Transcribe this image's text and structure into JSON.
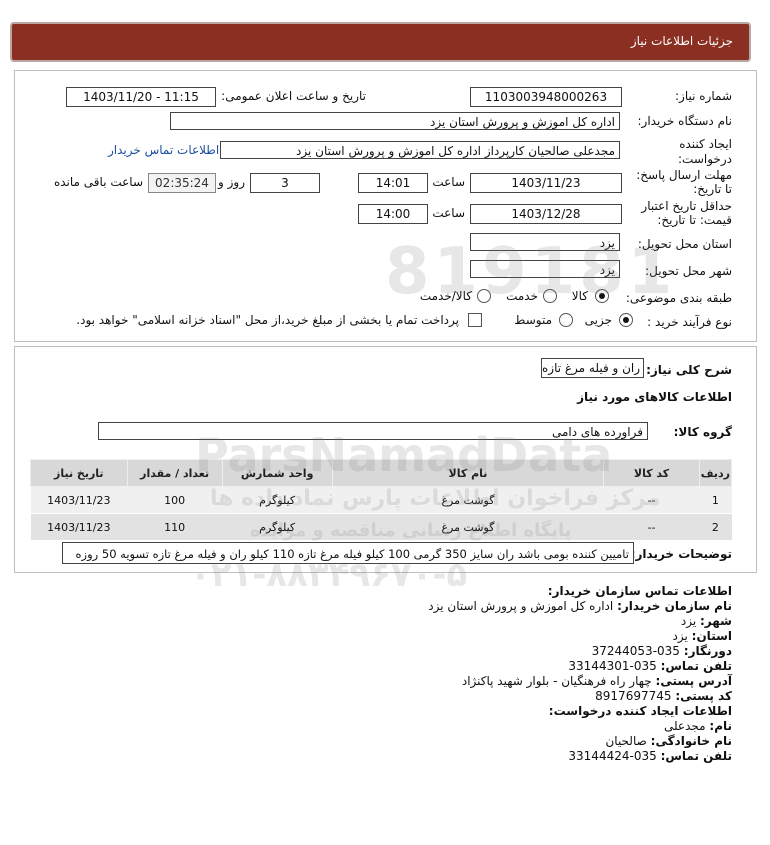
{
  "header": {
    "title": "جزئیات اطلاعات نیاز"
  },
  "form": {
    "need_number_label": "شماره نیاز:",
    "need_number": "1103003948000263",
    "announce_label": "تاریخ و ساعت اعلان عمومی:",
    "announce_value": "1403/11/20 - 11:15",
    "buyer_org_label": "نام دستگاه خریدار:",
    "buyer_org": "اداره کل اموزش و پرورش استان یزد",
    "creator_label_1": "ایجاد کننده",
    "creator_label_2": "درخواست:",
    "creator": "مجدعلی صالحیان کارپرداز اداره کل اموزش و پرورش استان یزد",
    "contact_link": "اطلاعات تماس خریدار",
    "deadline_label_1": "مهلت ارسال پاسخ:",
    "deadline_label_2": "تا تاریخ:",
    "deadline_date": "1403/11/23",
    "time_label": "ساعت",
    "deadline_time": "14:01",
    "days_value": "3",
    "days_label": "روز و",
    "countdown": "02:35:24",
    "remaining_label": "ساعت باقی مانده",
    "validity_label_1": "حداقل تاریخ اعتبار",
    "validity_label_2": "قیمت: تا تاریخ:",
    "validity_date": "1403/12/28",
    "validity_time": "14:00",
    "province_label": "استان محل تحویل:",
    "province": "یزد",
    "city_label": "شهر محل تحویل:",
    "city": "یزد",
    "category_label": "طبقه بندی موضوعی:",
    "category_options": [
      "کالا",
      "خدمت",
      "کالا/خدمت"
    ],
    "category_selected": "کالا",
    "process_label": "نوع فرآیند خرید :",
    "process_options": [
      "جزیی",
      "متوسط"
    ],
    "process_selected": "جزیی",
    "payment_note": "پرداخت تمام یا بخشی از مبلغ خرید،از محل \"اسناد خزانه اسلامی\" خواهد بود."
  },
  "description": {
    "label": "شرح کلی نیاز:",
    "value": "ران و فیله مرغ تازه",
    "goods_heading": "اطلاعات کالاهای مورد نیاز",
    "group_label": "گروه کالا:",
    "group_value": "فراورده های دامی"
  },
  "table": {
    "columns": [
      "ردیف",
      "کد کالا",
      "نام کالا",
      "واحد شمارش",
      "تعداد / مقدار",
      "تاریخ نیاز"
    ],
    "rows": [
      [
        "1",
        "--",
        "گوشت مرغ",
        "کیلوگرم",
        "100",
        "1403/11/23"
      ],
      [
        "2",
        "--",
        "گوشت مرغ",
        "کیلوگرم",
        "110",
        "1403/11/23"
      ]
    ]
  },
  "buyer_notes": {
    "label": "توضیحات خریدار:",
    "value": "تامیین کننده بومی باشد ران سایز 350 گرمی 100 کیلو فیله مرغ تازه 110 کیلو ران و فیله مرغ تازه تسویه 50 روزه"
  },
  "contact": {
    "heading": "اطلاعات تماس سازمان خریدار:",
    "org_label": "نام سازمان خریدار:",
    "org": "اداره کل اموزش و پرورش استان یزد",
    "city_label": "شهر:",
    "city": "یزد",
    "province_label": "استان:",
    "province": "یزد",
    "fax_label": "دورنگار:",
    "fax": "035-37244053",
    "phone_label": "تلفن تماس:",
    "phone": "035-33144301",
    "address_label": "آدرس پستی:",
    "address": "چهار راه فرهنگیان - بلوار شهید پاکنژاد",
    "postal_label": "کد پستی:",
    "postal": "8917697745",
    "creator_heading": "اطلاعات ایجاد کننده درخواست:",
    "name_label": "نام:",
    "name": "مجدعلی",
    "family_label": "نام خانوادگی:",
    "family": "صالحیان",
    "creator_phone_label": "تلفن تماس:",
    "creator_phone": "035-33144424"
  },
  "watermark": {
    "line1": "ParsNamadData",
    "line2": "مرکز فراخوان اطلاعات پارس نماد داده ها",
    "line3": "پایگاه اطلاع رسانی مناقصه و مزایده",
    "phone": "۰۲۱-۸۸۳۴۹۶۷۰-۵",
    "digits": "819181"
  },
  "colors": {
    "title_bar": "#8a2f22",
    "link": "#1d4fa0"
  }
}
